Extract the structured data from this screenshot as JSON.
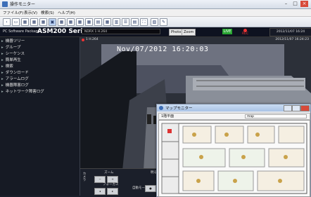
{
  "window": {
    "title": "操作モニター"
  },
  "menu": {
    "items": [
      "ファイル(F)",
      "表示(V)",
      "検索(S)",
      "ヘルプ(H)"
    ]
  },
  "header": {
    "brand_small": "PC Software Package",
    "brand_big": "ASM200 Series",
    "camera_field": "NDRX 1 H.264",
    "btn_photo": "Photo",
    "btn_zoom": "Zoom",
    "live": "LIVE",
    "rec": "REC",
    "datetime": "2012/11/07 16:24"
  },
  "sidebar": {
    "items": [
      "機器ツリー",
      "グループ",
      "シーケンス",
      "簡単再生",
      "検索",
      "ダウンロード",
      "アラームログ",
      "機器障害ログ",
      "ネットワーク障害ログ"
    ]
  },
  "video": {
    "camera_label": "1 H.264",
    "corner_time": "2012/11/07 16:24:23",
    "overlay_datetime": "Nov/07/2012 16:20:03"
  },
  "controls": {
    "camera_label": "カメラ",
    "zoom_label": "ズーム",
    "focus_label": "フォーカス",
    "auto_mode_label": "自動モード",
    "brightness_label": "明るさ"
  },
  "mapwin": {
    "title": "マップモニター",
    "left_field": "1階平面",
    "right_field": "map"
  }
}
